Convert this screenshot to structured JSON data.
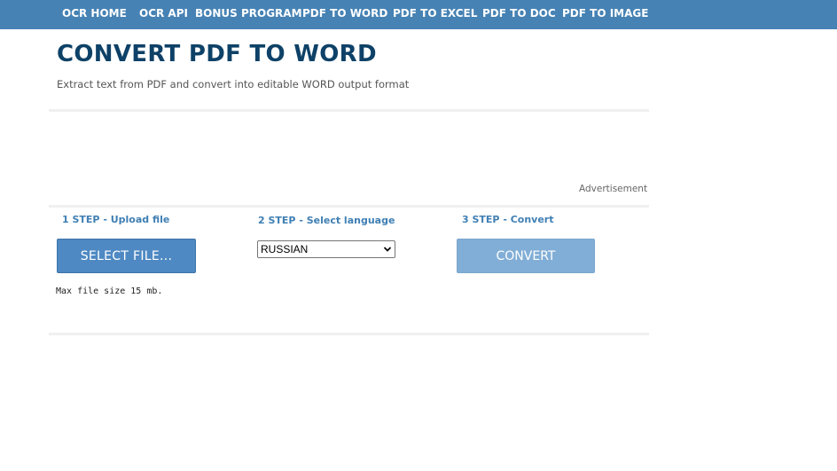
{
  "nav": {
    "items": [
      {
        "label": "OCR HOME"
      },
      {
        "label": "OCR API"
      },
      {
        "label": "BONUS PROGRAM"
      },
      {
        "label": "PDF TO WORD"
      },
      {
        "label": "PDF TO EXCEL"
      },
      {
        "label": "PDF TO DOC"
      },
      {
        "label": "PDF TO IMAGE"
      }
    ]
  },
  "header": {
    "title": "CONVERT PDF TO WORD",
    "subtitle": "Extract text from PDF and convert into editable WORD output format"
  },
  "ad": {
    "label": "Advertisement"
  },
  "steps": {
    "upload": {
      "label": "1 STEP - Upload file",
      "button": "SELECT FILE...",
      "note": "Max file size 15 mb."
    },
    "language": {
      "label": "2 STEP - Select language",
      "selected": "RUSSIAN"
    },
    "convert": {
      "label": "3 STEP - Convert",
      "button": "CONVERT"
    }
  },
  "colors": {
    "nav_bg": "#4682b4",
    "title": "#0e4167",
    "step_label": "#3f7fb3",
    "select_button": "#4f89c3",
    "convert_button": "#81aed6"
  },
  "icons": {
    "select_arrow": "chevron-down-icon"
  }
}
